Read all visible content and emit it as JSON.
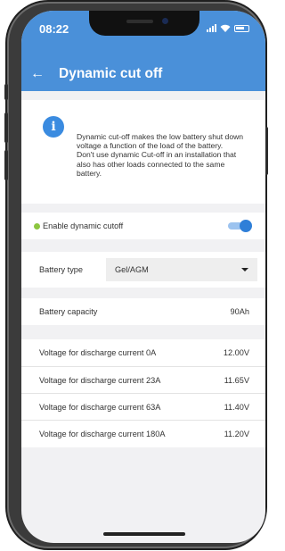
{
  "status_bar": {
    "time": "08:22"
  },
  "app_bar": {
    "back_label": "←",
    "title": "Dynamic cut off"
  },
  "info": {
    "icon": "info-icon",
    "icon_glyph": "i",
    "text_1": "Dynamic cut-off makes the low battery shut down voltage a function of the load of the battery.",
    "text_2": "Don't use dynamic Cut-off in an installation that also has other loads connected to the same battery."
  },
  "settings": {
    "dynamic_cutoff": {
      "label": "Enable dynamic cutoff",
      "enabled": true
    },
    "battery_type": {
      "label": "Battery type",
      "value": "Gel/AGM"
    },
    "battery_capacity": {
      "label": "Battery capacity",
      "value": "90Ah"
    },
    "voltages": [
      {
        "label": "Voltage for discharge current 0A",
        "value": "12.00V"
      },
      {
        "label": "Voltage for discharge current 23A",
        "value": "11.65V"
      },
      {
        "label": "Voltage for discharge current 63A",
        "value": "11.40V"
      },
      {
        "label": "Voltage for discharge current 180A",
        "value": "11.20V"
      }
    ]
  },
  "colors": {
    "primary": "#4a90d9",
    "toggle_on": "#2f7fd8",
    "status_dot": "#8cc63f"
  }
}
